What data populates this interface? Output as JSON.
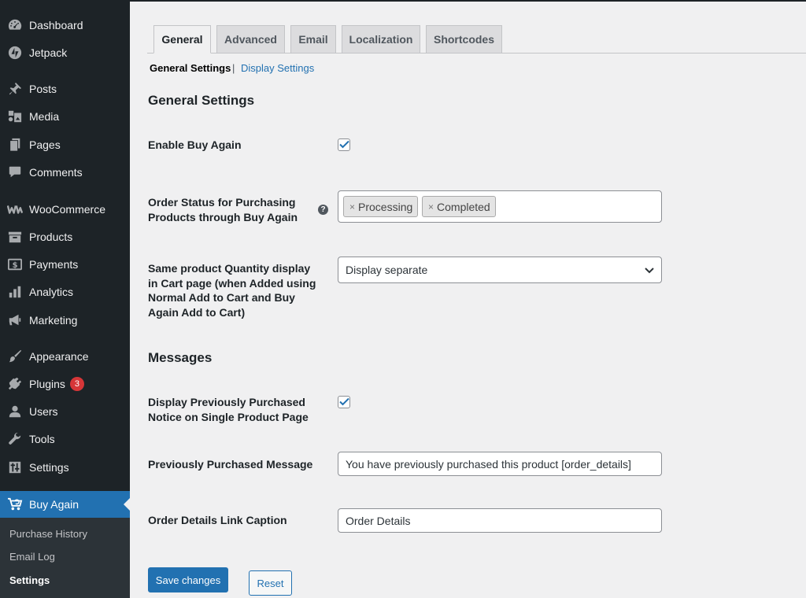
{
  "sidebar": {
    "items": [
      {
        "name": "dashboard",
        "label": "Dashboard",
        "icon": "dashboard-icon"
      },
      {
        "name": "jetpack",
        "label": "Jetpack",
        "icon": "jetpack-icon"
      },
      {
        "name": "posts",
        "label": "Posts",
        "icon": "pin-icon"
      },
      {
        "name": "media",
        "label": "Media",
        "icon": "media-icon"
      },
      {
        "name": "pages",
        "label": "Pages",
        "icon": "pages-icon"
      },
      {
        "name": "comments",
        "label": "Comments",
        "icon": "comment-icon"
      },
      {
        "name": "woocommerce",
        "label": "WooCommerce",
        "icon": "woocommerce-icon"
      },
      {
        "name": "products",
        "label": "Products",
        "icon": "archive-icon"
      },
      {
        "name": "payments",
        "label": "Payments",
        "icon": "dollar-icon"
      },
      {
        "name": "analytics",
        "label": "Analytics",
        "icon": "bar-chart-icon"
      },
      {
        "name": "marketing",
        "label": "Marketing",
        "icon": "megaphone-icon"
      },
      {
        "name": "appearance",
        "label": "Appearance",
        "icon": "paintbrush-icon"
      },
      {
        "name": "plugins",
        "label": "Plugins",
        "icon": "plug-icon",
        "badge": "3"
      },
      {
        "name": "users",
        "label": "Users",
        "icon": "user-icon"
      },
      {
        "name": "tools",
        "label": "Tools",
        "icon": "wrench-icon"
      },
      {
        "name": "settings",
        "label": "Settings",
        "icon": "sliders-icon"
      },
      {
        "name": "buy-again",
        "label": "Buy Again",
        "icon": "cart-icon"
      }
    ],
    "submenu": [
      "Purchase History",
      "Email Log",
      "Settings"
    ]
  },
  "tabs": [
    "General",
    "Advanced",
    "Email",
    "Localization",
    "Shortcodes"
  ],
  "subnav": {
    "current": "General Settings",
    "separator": "|",
    "link": "Display Settings"
  },
  "sections": {
    "general": "General Settings",
    "messages": "Messages"
  },
  "fields": {
    "enable_label": "Enable Buy Again",
    "order_status_label": "Order Status for Purchasing Products through Buy Again",
    "order_status_tags": [
      "Processing",
      "Completed"
    ],
    "tag_remove": "×",
    "help_icon_glyph": "?",
    "quantity_label": "Same product Quantity display in Cart page (when Added using Normal Add to Cart and Buy Again Add to Cart)",
    "quantity_value": "Display separate",
    "notice_label": "Display Previously Purchased Notice on Single Product Page",
    "message_label": "Previously Purchased Message",
    "message_value": "You have previously purchased this product [order_details]",
    "caption_label": "Order Details Link Caption",
    "caption_value": "Order Details"
  },
  "buttons": {
    "save": "Save changes",
    "reset": "Reset"
  },
  "colors": {
    "sidebar_bg": "#1d2327",
    "accent": "#2271b1",
    "badge": "#d63638"
  }
}
